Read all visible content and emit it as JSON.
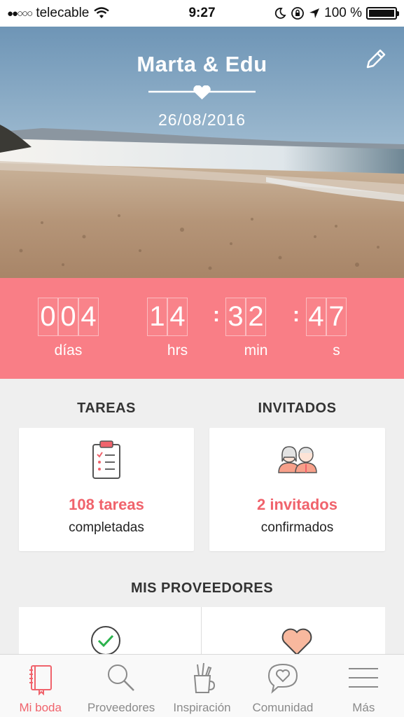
{
  "status_bar": {
    "carrier": "telecable",
    "time": "9:27",
    "battery_percent": "100 %",
    "battery_level": 1.0
  },
  "hero": {
    "couple_names": "Marta & Edu",
    "wedding_date": "26/08/2016"
  },
  "countdown": {
    "days": [
      "0",
      "0",
      "4"
    ],
    "hours": [
      "1",
      "4"
    ],
    "minutes": [
      "3",
      "2"
    ],
    "seconds": [
      "4",
      "7"
    ],
    "labels": {
      "days": "días",
      "hours": "hrs",
      "minutes": "min",
      "seconds": "s"
    },
    "colors": {
      "background": "#f97e86"
    }
  },
  "tasks": {
    "heading": "TAREAS",
    "count": "108 tareas",
    "status": "completadas",
    "icon": "clipboard-checklist-icon"
  },
  "guests": {
    "heading": "INVITADOS",
    "count": "2 invitados",
    "status": "confirmados",
    "icon": "couple-guests-icon"
  },
  "vendors": {
    "heading": "MIS PROVEEDORES",
    "icons": [
      "check-circle-icon",
      "heart-icon"
    ]
  },
  "tabbar": {
    "items": [
      {
        "label": "Mi boda",
        "icon": "notebook-icon",
        "active": true
      },
      {
        "label": "Proveedores",
        "icon": "search-icon",
        "active": false
      },
      {
        "label": "Inspiración",
        "icon": "brush-jar-icon",
        "active": false
      },
      {
        "label": "Comunidad",
        "icon": "chat-heart-icon",
        "active": false
      },
      {
        "label": "Más",
        "icon": "menu-icon",
        "active": false
      }
    ]
  },
  "colors": {
    "accent": "#f0636c",
    "countdown_bg": "#f97e86",
    "page_bg": "#efefef"
  }
}
